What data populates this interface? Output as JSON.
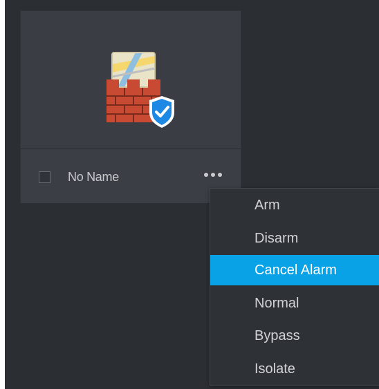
{
  "card": {
    "name": "No Name",
    "checked": false,
    "icon": "firewall-shield-icon",
    "more_icon": "more-horizontal-icon"
  },
  "context_menu": {
    "items": [
      {
        "label": "Arm",
        "active": false
      },
      {
        "label": "Disarm",
        "active": false
      },
      {
        "label": "Cancel Alarm",
        "active": true
      },
      {
        "label": "Normal",
        "active": false
      },
      {
        "label": "Bypass",
        "active": false
      },
      {
        "label": "Isolate",
        "active": false
      }
    ]
  },
  "colors": {
    "background": "#2b2e33",
    "card": "#3a3e44",
    "accent": "#0aa2e6",
    "brick": "#c94a32",
    "shield": "#1e88e5"
  }
}
